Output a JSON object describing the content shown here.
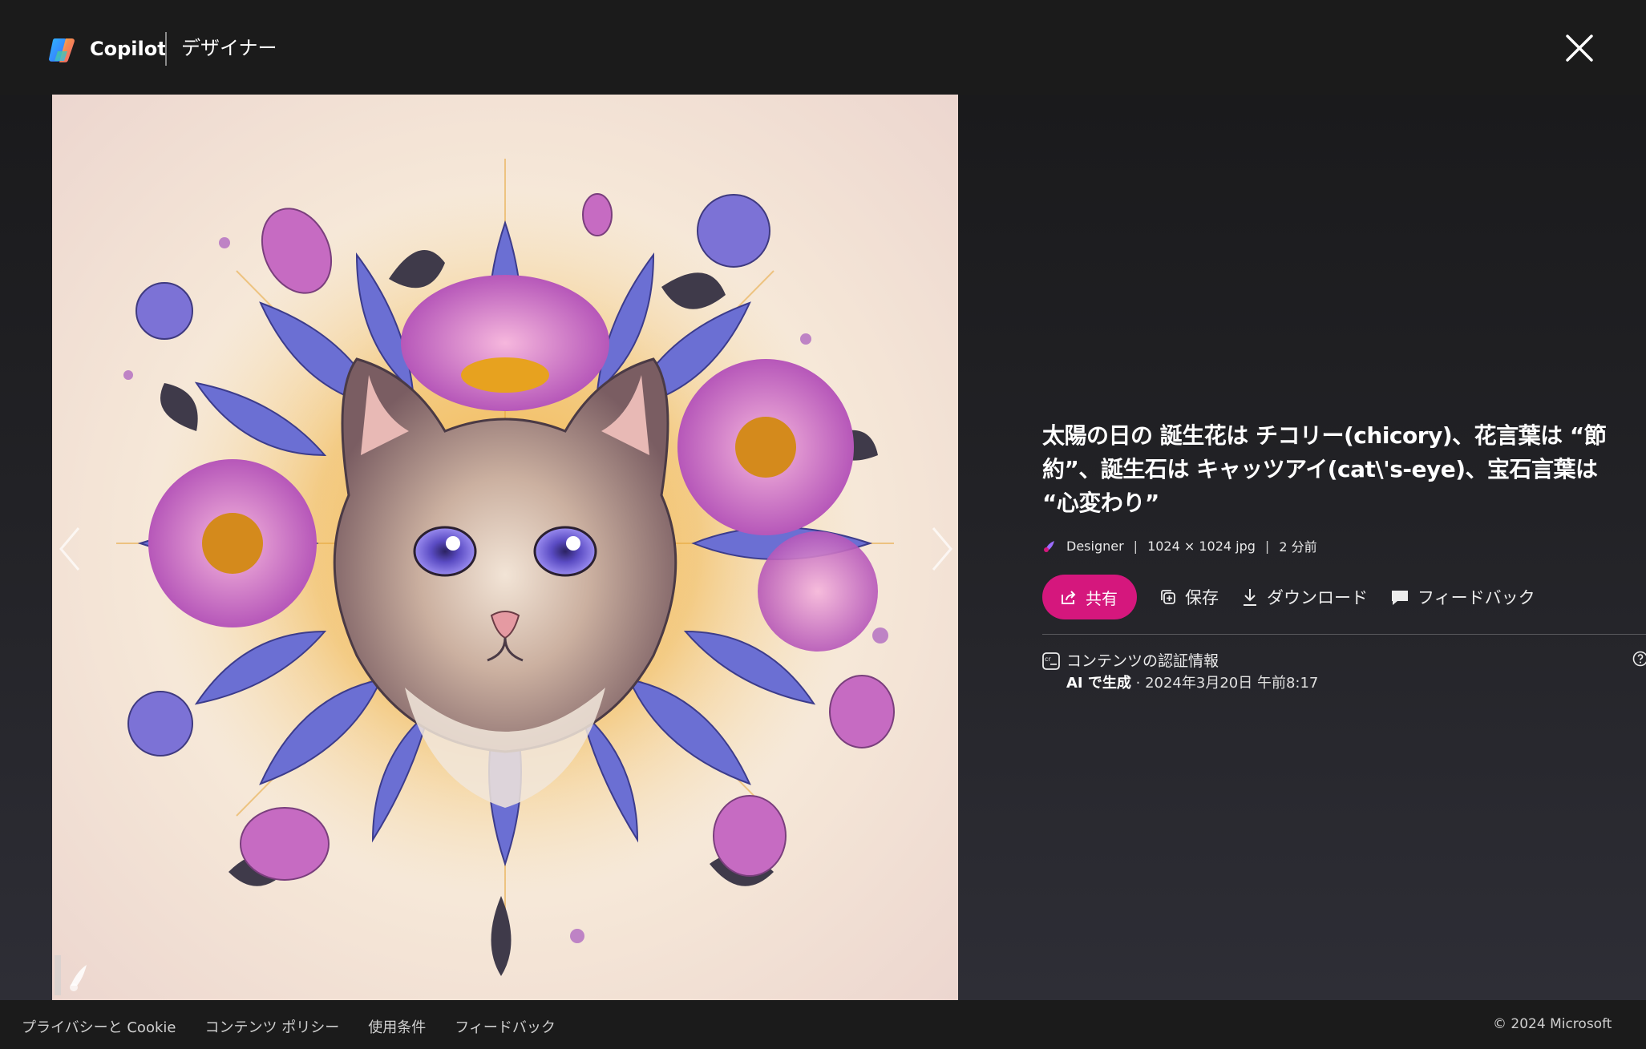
{
  "header": {
    "brand": "Copilot",
    "section": "デザイナー",
    "close_icon": "close-icon"
  },
  "image": {
    "subject": "cat-flower-illustration"
  },
  "info": {
    "title": "太陽の日の 誕生花は チコリー(chicory)、花言葉は “節約”、誕生石は キャッツアイ(cat\\'s-eye)、宝石言葉は “心変わり”",
    "meta": {
      "source": "Designer",
      "dimensions": "1024 × 1024 jpg",
      "time": "2 分前"
    },
    "actions": {
      "share": "共有",
      "save": "保存",
      "download": "ダウンロード",
      "feedback": "フィードバック"
    },
    "credentials": {
      "title": "コンテンツの認証情報",
      "generated_label": "AI で生成",
      "generated_detail": " · 2024年3月20日 午前8:17"
    }
  },
  "footer": {
    "links": [
      "プライバシーと Cookie",
      "コンテンツ ポリシー",
      "使用条件",
      "フィードバック"
    ],
    "copyright": "© 2024 Microsoft"
  },
  "colors": {
    "accent": "#d5177d",
    "background": "#1b1b1b"
  }
}
